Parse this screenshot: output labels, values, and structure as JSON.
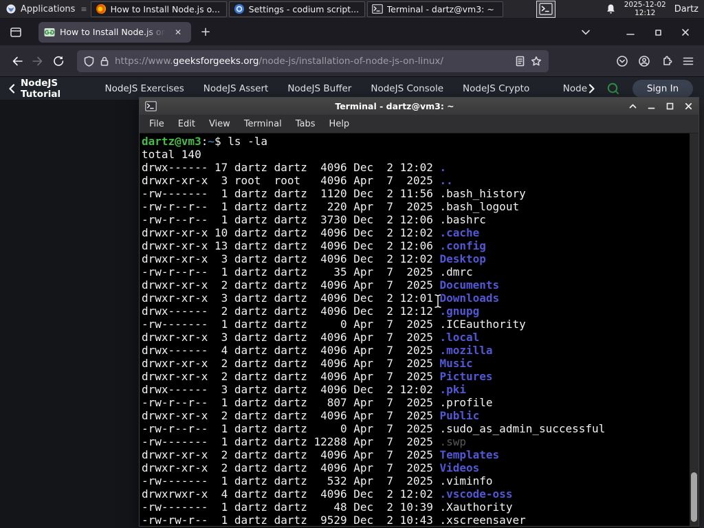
{
  "panel": {
    "applications_label": "Applications",
    "separator_glyph": "≡",
    "windows": [
      {
        "title": "How to Install Node.js o...",
        "icon": "firefox"
      },
      {
        "title": "Settings - codium script...",
        "icon": "codium"
      },
      {
        "title": "Terminal - dartz@vm3: ~",
        "icon": "terminal"
      }
    ],
    "clock_date": "2025-12-02",
    "clock_time": "12:12",
    "user": "Dartz"
  },
  "browser": {
    "tab_title": "How to Install Node.js on",
    "new_tab_glyph": "+",
    "close_glyph": "✕",
    "url": {
      "scheme": "https://www.",
      "domain": "geeksforgeeks.org",
      "path": "/node-js/installation-of-node-js-on-linux/"
    }
  },
  "sitenav": {
    "back_label": "NodeJS Tutorial",
    "links": [
      "NodeJS Exercises",
      "NodeJS Assert",
      "NodeJS Buffer",
      "NodeJS Console",
      "NodeJS Crypto",
      "NodeJS DNS"
    ],
    "truncated_link": "Node",
    "sign_in_label": "Sign In",
    "accent_green": "#2f8d46"
  },
  "terminal": {
    "title": "Terminal - dartz@vm3: ~",
    "menu": [
      "File",
      "Edit",
      "View",
      "Terminal",
      "Tabs",
      "Help"
    ],
    "prompt": {
      "userhost": "dartz@vm3",
      "colon": ":",
      "path": "~",
      "rest": "$ ls -la"
    },
    "total_line": "total 140",
    "colors": {
      "background": "#000000",
      "foreground": "#f2f2f2",
      "prompt_green": "#44bd44",
      "prompt_path_blue": "#3a6ea5",
      "dir_blue": "#5257d6",
      "dim_gray": "#585858"
    },
    "rows": [
      {
        "pre": "drwx------ 17 dartz dartz  4096 Dec  2 12:02 ",
        "name": ".",
        "type": "dir"
      },
      {
        "pre": "drwxr-xr-x  3 root  root   4096 Apr  7  2025 ",
        "name": "..",
        "type": "dir"
      },
      {
        "pre": "-rw-------  1 dartz dartz  1120 Dec  2 11:56 ",
        "name": ".bash_history",
        "type": "file"
      },
      {
        "pre": "-rw-r--r--  1 dartz dartz   220 Apr  7  2025 ",
        "name": ".bash_logout",
        "type": "file"
      },
      {
        "pre": "-rw-r--r--  1 dartz dartz  3730 Dec  2 12:06 ",
        "name": ".bashrc",
        "type": "file"
      },
      {
        "pre": "drwxr-xr-x 10 dartz dartz  4096 Dec  2 12:02 ",
        "name": ".cache",
        "type": "dir"
      },
      {
        "pre": "drwxr-xr-x 13 dartz dartz  4096 Dec  2 12:06 ",
        "name": ".config",
        "type": "dir"
      },
      {
        "pre": "drwxr-xr-x  3 dartz dartz  4096 Dec  2 12:02 ",
        "name": "Desktop",
        "type": "dir"
      },
      {
        "pre": "-rw-r--r--  1 dartz dartz    35 Apr  7  2025 ",
        "name": ".dmrc",
        "type": "file"
      },
      {
        "pre": "drwxr-xr-x  2 dartz dartz  4096 Apr  7  2025 ",
        "name": "Documents",
        "type": "dir"
      },
      {
        "pre": "drwxr-xr-x  3 dartz dartz  4096 Dec  2 12:01 ",
        "name": "Downloads",
        "type": "dir"
      },
      {
        "pre": "drwx------  2 dartz dartz  4096 Dec  2 12:12 ",
        "name": ".gnupg",
        "type": "dir"
      },
      {
        "pre": "-rw-------  1 dartz dartz     0 Apr  7  2025 ",
        "name": ".ICEauthority",
        "type": "file"
      },
      {
        "pre": "drwxr-xr-x  3 dartz dartz  4096 Apr  7  2025 ",
        "name": ".local",
        "type": "dir"
      },
      {
        "pre": "drwx------  4 dartz dartz  4096 Apr  7  2025 ",
        "name": ".mozilla",
        "type": "dir"
      },
      {
        "pre": "drwxr-xr-x  2 dartz dartz  4096 Apr  7  2025 ",
        "name": "Music",
        "type": "dir"
      },
      {
        "pre": "drwxr-xr-x  2 dartz dartz  4096 Apr  7  2025 ",
        "name": "Pictures",
        "type": "dir"
      },
      {
        "pre": "drwx------  3 dartz dartz  4096 Dec  2 12:02 ",
        "name": ".pki",
        "type": "dir"
      },
      {
        "pre": "-rw-r--r--  1 dartz dartz   807 Apr  7  2025 ",
        "name": ".profile",
        "type": "file"
      },
      {
        "pre": "drwxr-xr-x  2 dartz dartz  4096 Apr  7  2025 ",
        "name": "Public",
        "type": "dir"
      },
      {
        "pre": "-rw-r--r--  1 dartz dartz     0 Apr  7  2025 ",
        "name": ".sudo_as_admin_successful",
        "type": "file"
      },
      {
        "pre": "-rw-------  1 dartz dartz 12288 Apr  7  2025 ",
        "name": ".swp",
        "type": "dim"
      },
      {
        "pre": "drwxr-xr-x  2 dartz dartz  4096 Apr  7  2025 ",
        "name": "Templates",
        "type": "dir"
      },
      {
        "pre": "drwxr-xr-x  2 dartz dartz  4096 Apr  7  2025 ",
        "name": "Videos",
        "type": "dir"
      },
      {
        "pre": "-rw-------  1 dartz dartz   532 Apr  7  2025 ",
        "name": ".viminfo",
        "type": "file"
      },
      {
        "pre": "drwxrwxr-x  4 dartz dartz  4096 Dec  2 12:02 ",
        "name": ".vscode-oss",
        "type": "dir"
      },
      {
        "pre": "-rw-------  1 dartz dartz    48 Dec  2 10:39 ",
        "name": ".Xauthority",
        "type": "file"
      },
      {
        "pre": "-rw-rw-r--  1 dartz dartz  9529 Dec  2 10:43 ",
        "name": ".xscreensaver",
        "type": "file"
      }
    ]
  }
}
